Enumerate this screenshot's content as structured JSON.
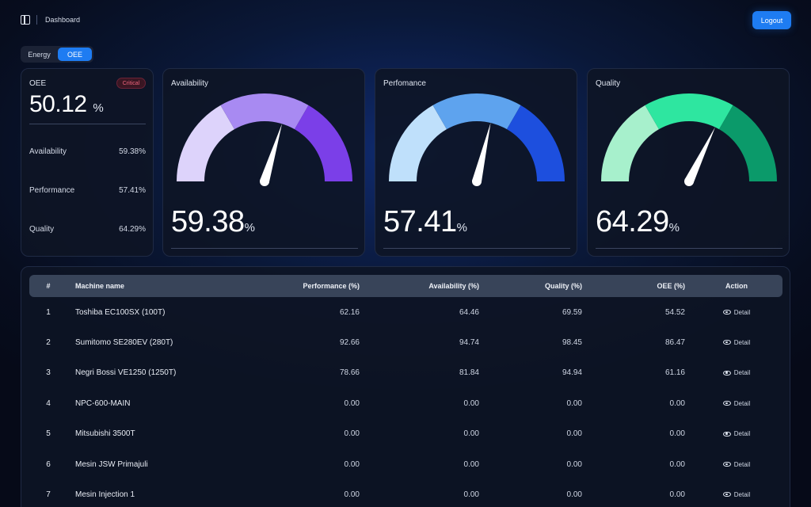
{
  "header": {
    "breadcrumb": "Dashboard",
    "logout_label": "Logout"
  },
  "tabs": [
    {
      "label": "Energy",
      "active": false
    },
    {
      "label": "OEE",
      "active": true
    }
  ],
  "summary": {
    "title": "OEE",
    "badge": "Critical",
    "value": "50.12",
    "unit": "%",
    "metrics": [
      {
        "label": "Availability",
        "value": "59.38%"
      },
      {
        "label": "Performance",
        "value": "57.41%"
      },
      {
        "label": "Quality",
        "value": "64.29%"
      }
    ]
  },
  "gauges": [
    {
      "title": "Availability",
      "value": "59.38",
      "unit": "%",
      "fraction": 0.5938,
      "colors": [
        "#ddd3fb",
        "#a88af2",
        "#7b3fe8"
      ]
    },
    {
      "title": "Perfomance",
      "value": "57.41",
      "unit": "%",
      "fraction": 0.5741,
      "colors": [
        "#bfe0fb",
        "#5ea3ee",
        "#1d4fde"
      ]
    },
    {
      "title": "Quality",
      "value": "64.29",
      "unit": "%",
      "fraction": 0.6429,
      "colors": [
        "#a7f0cc",
        "#2ee6a0",
        "#0b9a6a"
      ]
    }
  ],
  "table": {
    "headers": {
      "index": "#",
      "name": "Machine name",
      "performance": "Performance (%)",
      "availability": "Availability (%)",
      "quality": "Quality (%)",
      "oee": "OEE (%)",
      "action": "Action"
    },
    "action_label": "Detail",
    "rows": [
      {
        "index": "1",
        "name": "Toshiba EC100SX (100T)",
        "performance": "62.16",
        "availability": "64.46",
        "quality": "69.59",
        "oee": "54.52"
      },
      {
        "index": "2",
        "name": "Sumitomo SE280EV (280T)",
        "performance": "92.66",
        "availability": "94.74",
        "quality": "98.45",
        "oee": "86.47"
      },
      {
        "index": "3",
        "name": "Negri Bossi VE1250 (1250T)",
        "performance": "78.66",
        "availability": "81.84",
        "quality": "94.94",
        "oee": "61.16"
      },
      {
        "index": "4",
        "name": "NPC-600-MAIN",
        "performance": "0.00",
        "availability": "0.00",
        "quality": "0.00",
        "oee": "0.00"
      },
      {
        "index": "5",
        "name": "Mitsubishi 3500T",
        "performance": "0.00",
        "availability": "0.00",
        "quality": "0.00",
        "oee": "0.00"
      },
      {
        "index": "6",
        "name": "Mesin JSW Primajuli",
        "performance": "0.00",
        "availability": "0.00",
        "quality": "0.00",
        "oee": "0.00"
      },
      {
        "index": "7",
        "name": "Mesin Injection 1",
        "performance": "0.00",
        "availability": "0.00",
        "quality": "0.00",
        "oee": "0.00"
      }
    ]
  }
}
